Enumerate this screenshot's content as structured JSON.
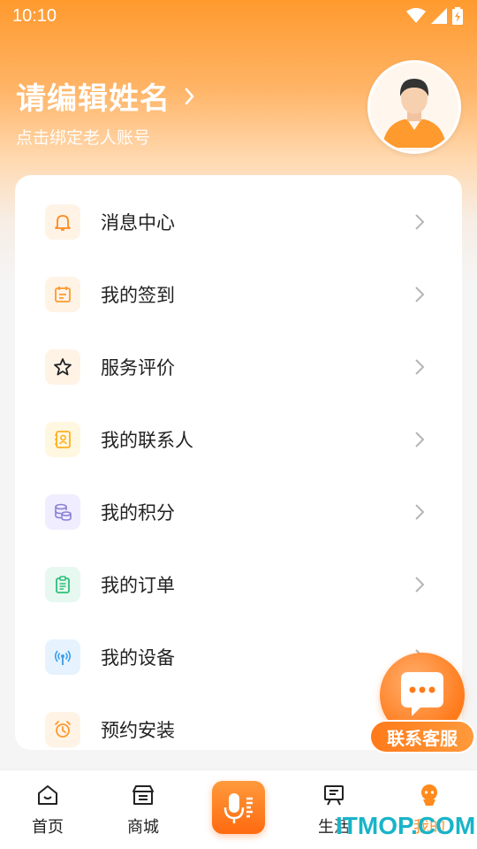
{
  "status_bar": {
    "time": "10:10"
  },
  "profile": {
    "name": "请编辑姓名",
    "subtitle": "点击绑定老人账号"
  },
  "menu": {
    "items": [
      {
        "label": "消息中心",
        "icon": "bell-icon",
        "icon_color": "#ff8a1e",
        "icon_bg": "#fff3e6"
      },
      {
        "label": "我的签到",
        "icon": "calendar-icon",
        "icon_color": "#ff9a2e",
        "icon_bg": "#fff3e6"
      },
      {
        "label": "服务评价",
        "icon": "star-icon",
        "icon_color": "#222222",
        "icon_bg": "#fff3e6"
      },
      {
        "label": "我的联系人",
        "icon": "contact-icon",
        "icon_color": "#ffb020",
        "icon_bg": "#fff7e0"
      },
      {
        "label": "我的积分",
        "icon": "coins-icon",
        "icon_color": "#8a7fd6",
        "icon_bg": "#efedff"
      },
      {
        "label": "我的订单",
        "icon": "clipboard-icon",
        "icon_color": "#2fbf7a",
        "icon_bg": "#e6f8ef"
      },
      {
        "label": "我的设备",
        "icon": "device-signal-icon",
        "icon_color": "#3a9ee8",
        "icon_bg": "#e6f3ff"
      },
      {
        "label": "预约安装",
        "icon": "alarm-clock-icon",
        "icon_color": "#ff9a2e",
        "icon_bg": "#fff3e6"
      }
    ]
  },
  "customer_service": {
    "label": "联系客服"
  },
  "tabbar": {
    "tabs": [
      {
        "label": "首页",
        "icon": "home-icon"
      },
      {
        "label": "商城",
        "icon": "store-icon"
      },
      {
        "label": "",
        "icon": "mic-icon"
      },
      {
        "label": "生活",
        "icon": "board-icon"
      },
      {
        "label": "我的",
        "icon": "profile-icon"
      }
    ],
    "active_index": 4
  },
  "watermark": "ITMOP.COM",
  "colors": {
    "accent": "#ff8a1e",
    "chevron": "#b5b5b5"
  }
}
